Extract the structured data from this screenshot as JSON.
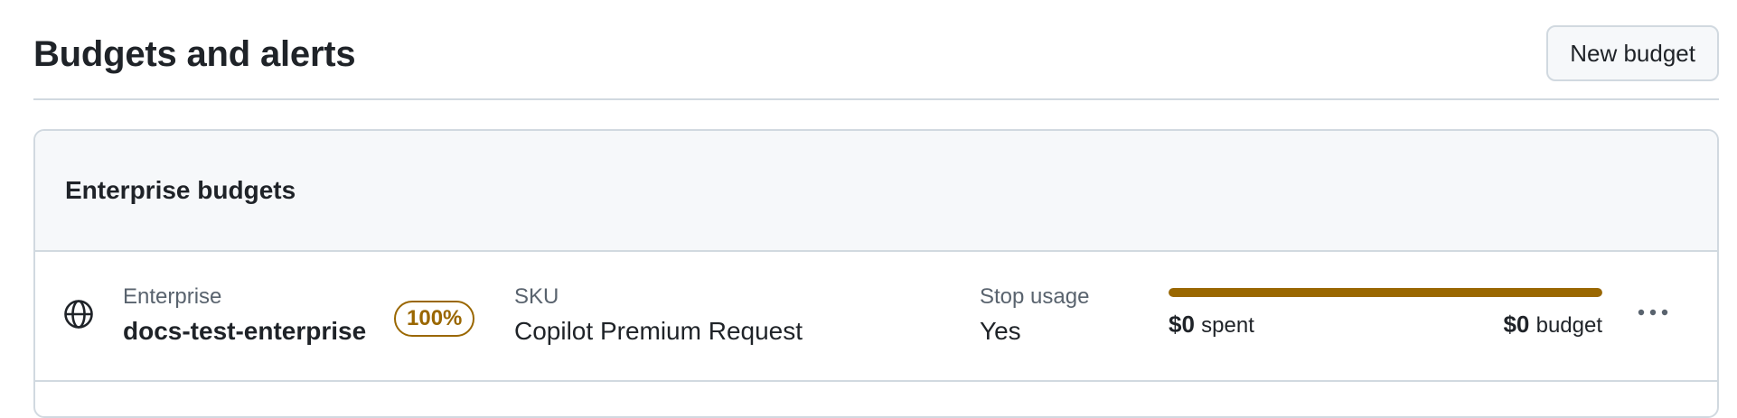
{
  "header": {
    "title": "Budgets and alerts",
    "new_budget_label": "New budget"
  },
  "card": {
    "title": "Enterprise budgets",
    "rows": [
      {
        "icon": "globe-icon",
        "scope_label": "Enterprise",
        "scope_value": "docs-test-enterprise",
        "percent_badge": "100%",
        "sku_label": "SKU",
        "sku_value": "Copilot Premium Request",
        "stop_label": "Stop usage",
        "stop_value": "Yes",
        "progress_percent": 100,
        "spent_amount": "$0",
        "spent_unit": "spent",
        "budget_amount": "$0",
        "budget_unit": "budget",
        "menu_icon": "kebab-horizontal-icon"
      }
    ]
  },
  "colors": {
    "attention": "#9a6700",
    "border": "#d1d9e0",
    "muted_text": "#59636e",
    "header_bg": "#f6f8fa"
  }
}
